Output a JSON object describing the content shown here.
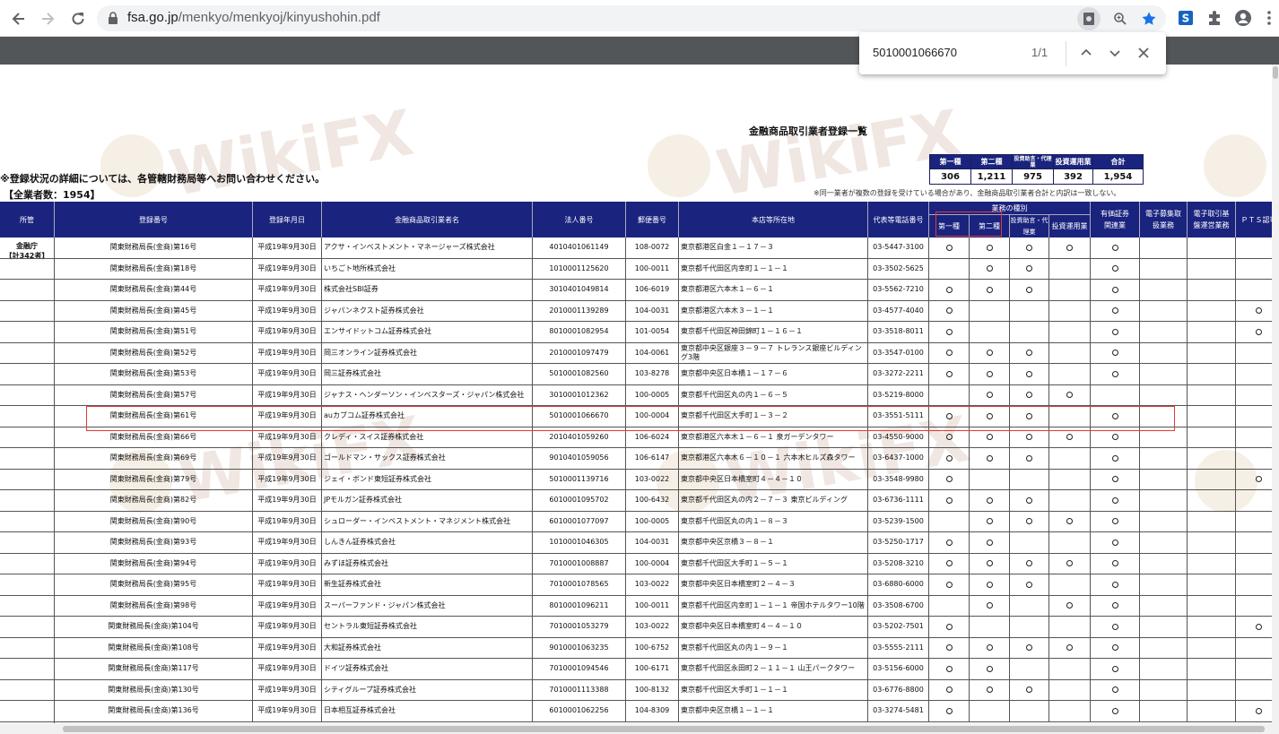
{
  "browser": {
    "url_host": "fsa.go.jp",
    "url_path": "/menkyo/menkyoj/kinyushohin.pdf"
  },
  "find": {
    "query": "5010001066670",
    "count": "1/1"
  },
  "doc": {
    "title": "金融商品取引業者登録一覧",
    "notice": "※登録状況の詳細については、各管轄財務局等へお問い合わせください。",
    "total": "【全業者数：1954】",
    "footnote": "※同一業者が複数の登録を受けている場合があり、金融商品取引業者合計と内訳は一致しない。",
    "agency": "金融庁",
    "agency_count": "【計342者】"
  },
  "summary": {
    "headers": [
      "第一種",
      "第二種",
      "投資助言・代理業",
      "投資運用業",
      "合計"
    ],
    "values": [
      "306",
      "1,211",
      "975",
      "392",
      "1,954"
    ]
  },
  "table": {
    "headers": {
      "jurisdiction": "所管",
      "reg_no": "登録番号",
      "reg_date": "登録年月日",
      "name": "金融商品取引業者名",
      "corp_no": "法人番号",
      "postal": "郵便番号",
      "address": "本店等所在地",
      "phone": "代表等電話番号",
      "business_type": "業務の種別",
      "type1": "第一種",
      "type2": "第二種",
      "advisory": "投資助言・代理業",
      "asset_mgmt": "投資運用業",
      "securities_related": "有価証券関連業",
      "crowdfunding": "電子募集取扱業務",
      "electronic_platform": "電子取引基盤運営業務",
      "pts": "ＰＴＳ認可"
    },
    "rows": [
      {
        "reg": "関東財務局長(金商)第16号",
        "date": "平成19年9月30日",
        "name": "アクサ・インベストメント・マネージャーズ株式会社",
        "corp": "4010401061149",
        "zip": "108-0072",
        "addr": "東京都港区白金１－１７－３",
        "tel": "03-5447-3100",
        "f": [
          1,
          1,
          1,
          1,
          1,
          0,
          0,
          0
        ]
      },
      {
        "reg": "関東財務局長(金商)第18号",
        "date": "平成19年9月30日",
        "name": "いちごト地所株式会社",
        "corp": "1010001125620",
        "zip": "100-0011",
        "addr": "東京都千代田区内幸町１－１－１",
        "tel": "03-3502-5625",
        "f": [
          0,
          1,
          1,
          0,
          1,
          0,
          0,
          0
        ]
      },
      {
        "reg": "関東財務局長(金商)第44号",
        "date": "平成19年9月30日",
        "name": "株式会社SBI証券",
        "corp": "3010401049814",
        "zip": "106-6019",
        "addr": "東京都港区六本木１－６－１",
        "tel": "03-5562-7210",
        "f": [
          1,
          1,
          1,
          0,
          1,
          0,
          0,
          0
        ]
      },
      {
        "reg": "関東財務局長(金商)第45号",
        "date": "平成19年9月30日",
        "name": "ジャパンネクスト証券株式会社",
        "corp": "2010001139289",
        "zip": "104-0031",
        "addr": "東京都港区六本木３－１－１",
        "tel": "03-4577-4040",
        "f": [
          1,
          0,
          0,
          0,
          1,
          0,
          0,
          1
        ]
      },
      {
        "reg": "関東財務局長(金商)第51号",
        "date": "平成19年9月30日",
        "name": "エンサイドットコム証券株式会社",
        "corp": "8010001082954",
        "zip": "101-0054",
        "addr": "東京都千代田区神田錦町１－１６－１",
        "tel": "03-3518-8011",
        "f": [
          1,
          0,
          0,
          0,
          1,
          0,
          0,
          1
        ]
      },
      {
        "reg": "関東財務局長(金商)第52号",
        "date": "平成19年9月30日",
        "name": "岡三オンライン証券株式会社",
        "corp": "2010001097479",
        "zip": "104-0061",
        "addr": "東京都中央区銀座３－９－７ トレランス銀座ビルディング3階",
        "tel": "03-3547-0100",
        "f": [
          1,
          1,
          1,
          0,
          1,
          0,
          0,
          0
        ]
      },
      {
        "reg": "関東財務局長(金商)第53号",
        "date": "平成19年9月30日",
        "name": "岡三証券株式会社",
        "corp": "5010001082560",
        "zip": "103-8278",
        "addr": "東京都中央区日本橋１－１７－６",
        "tel": "03-3272-2211",
        "f": [
          1,
          1,
          1,
          0,
          1,
          0,
          0,
          0
        ]
      },
      {
        "reg": "関東財務局長(金商)第57号",
        "date": "平成19年9月30日",
        "name": "ジャナス・ヘンダーソン・インベスターズ・ジャパン株式会社",
        "corp": "3010001012362",
        "zip": "100-0005",
        "addr": "東京都千代田区丸の内１－６－５",
        "tel": "03-5219-8000",
        "f": [
          0,
          1,
          1,
          1,
          0,
          0,
          0,
          0
        ]
      },
      {
        "reg": "関東財務局長(金商)第61号",
        "date": "平成19年9月30日",
        "name": "auカブコム証券株式会社",
        "corp": "5010001066670",
        "zip": "100-0004",
        "addr": "東京都千代田区大手町１－３－２",
        "tel": "03-3551-5111",
        "f": [
          1,
          1,
          1,
          0,
          1,
          0,
          0,
          0
        ]
      },
      {
        "reg": "関東財務局長(金商)第66号",
        "date": "平成19年9月30日",
        "name": "クレディ・スイス証券株式会社",
        "corp": "2010401059260",
        "zip": "106-6024",
        "addr": "東京都港区六本木１－６－１ 泉ガーデンタワー",
        "tel": "03-4550-9000",
        "f": [
          1,
          1,
          1,
          1,
          1,
          0,
          0,
          0
        ]
      },
      {
        "reg": "関東財務局長(金商)第69号",
        "date": "平成19年9月30日",
        "name": "ゴールドマン・サックス証券株式会社",
        "corp": "9010401059056",
        "zip": "106-6147",
        "addr": "東京都港区六本木６－１０－１ 六本木ヒルズ森タワー",
        "tel": "03-6437-1000",
        "f": [
          1,
          1,
          1,
          0,
          1,
          0,
          0,
          0
        ]
      },
      {
        "reg": "関東財務局長(金商)第79号",
        "date": "平成19年9月30日",
        "name": "ジェイ・ボンド東短証券株式会社",
        "corp": "5010001139716",
        "zip": "103-0022",
        "addr": "東京都中央区日本橋室町４－４－１０",
        "tel": "03-3548-9980",
        "f": [
          1,
          0,
          0,
          0,
          1,
          0,
          0,
          1
        ]
      },
      {
        "reg": "関東財務局長(金商)第82号",
        "date": "平成19年9月30日",
        "name": "JPモルガン証券株式会社",
        "corp": "6010001095702",
        "zip": "100-6432",
        "addr": "東京都千代田区丸の内２－７－３ 東京ビルディング",
        "tel": "03-6736-1111",
        "f": [
          1,
          1,
          1,
          0,
          1,
          0,
          0,
          0
        ]
      },
      {
        "reg": "関東財務局長(金商)第90号",
        "date": "平成19年9月30日",
        "name": "シュローダー・インベストメント・マネジメント株式会社",
        "corp": "6010001077097",
        "zip": "100-0005",
        "addr": "東京都千代田区丸の内１－８－３",
        "tel": "03-5239-1500",
        "f": [
          0,
          1,
          1,
          1,
          1,
          0,
          0,
          0
        ]
      },
      {
        "reg": "関東財務局長(金商)第93号",
        "date": "平成19年9月30日",
        "name": "しんきん証券株式会社",
        "corp": "1010001046305",
        "zip": "104-0031",
        "addr": "東京都中央区京橋３－８－１",
        "tel": "03-5250-1717",
        "f": [
          1,
          1,
          0,
          0,
          1,
          0,
          0,
          0
        ]
      },
      {
        "reg": "関東財務局長(金商)第94号",
        "date": "平成19年9月30日",
        "name": "みずほ証券株式会社",
        "corp": "7010001008887",
        "zip": "100-0004",
        "addr": "東京都千代田区大手町１－５－１",
        "tel": "03-5208-3210",
        "f": [
          1,
          1,
          1,
          1,
          1,
          0,
          0,
          0
        ]
      },
      {
        "reg": "関東財務局長(金商)第95号",
        "date": "平成19年9月30日",
        "name": "新生証券株式会社",
        "corp": "7010001078565",
        "zip": "103-0022",
        "addr": "東京都中央区日本橋室町２－４－３",
        "tel": "03-6880-6000",
        "f": [
          1,
          1,
          1,
          0,
          1,
          0,
          0,
          0
        ]
      },
      {
        "reg": "関東財務局長(金商)第98号",
        "date": "平成19年9月30日",
        "name": "スーパーファンド・ジャパン株式会社",
        "corp": "8010001096211",
        "zip": "100-0011",
        "addr": "東京都千代田区内幸町１－１－１ 帝国ホテルタワー10階",
        "tel": "03-3508-6700",
        "f": [
          0,
          1,
          0,
          1,
          1,
          0,
          0,
          0
        ]
      },
      {
        "reg": "関東財務局長(金商)第104号",
        "date": "平成19年9月30日",
        "name": "セントラル東短証券株式会社",
        "corp": "7010001053279",
        "zip": "103-0022",
        "addr": "東京都中央区日本橋室町４－４－１０",
        "tel": "03-5202-7501",
        "f": [
          1,
          0,
          0,
          0,
          1,
          0,
          0,
          1
        ]
      },
      {
        "reg": "関東財務局長(金商)第108号",
        "date": "平成19年9月30日",
        "name": "大和証券株式会社",
        "corp": "9010001063235",
        "zip": "100-6752",
        "addr": "東京都千代田区丸の内１－９－１",
        "tel": "03-5555-2111",
        "f": [
          1,
          1,
          1,
          1,
          1,
          0,
          0,
          0
        ]
      },
      {
        "reg": "関東財務局長(金商)第117号",
        "date": "平成19年9月30日",
        "name": "ドイツ証券株式会社",
        "corp": "7010001094546",
        "zip": "100-6171",
        "addr": "東京都千代田区永田町２－１１－１ 山王パークタワー",
        "tel": "03-5156-6000",
        "f": [
          1,
          1,
          0,
          0,
          1,
          0,
          0,
          0
        ]
      },
      {
        "reg": "関東財務局長(金商)第130号",
        "date": "平成19年9月30日",
        "name": "シティグループ証券株式会社",
        "corp": "7010001113388",
        "zip": "100-8132",
        "addr": "東京都千代田区大手町１－１－１",
        "tel": "03-6776-8800",
        "f": [
          1,
          1,
          1,
          0,
          1,
          0,
          0,
          0
        ]
      },
      {
        "reg": "関東財務局長(金商)第136号",
        "date": "平成19年9月30日",
        "name": "日本相互証券株式会社",
        "corp": "6010001062256",
        "zip": "104-8309",
        "addr": "東京都中央区京橋１－１－１",
        "tel": "03-3274-5481",
        "f": [
          1,
          0,
          0,
          0,
          1,
          0,
          0,
          1
        ]
      }
    ]
  },
  "watermark": "WikiFX"
}
